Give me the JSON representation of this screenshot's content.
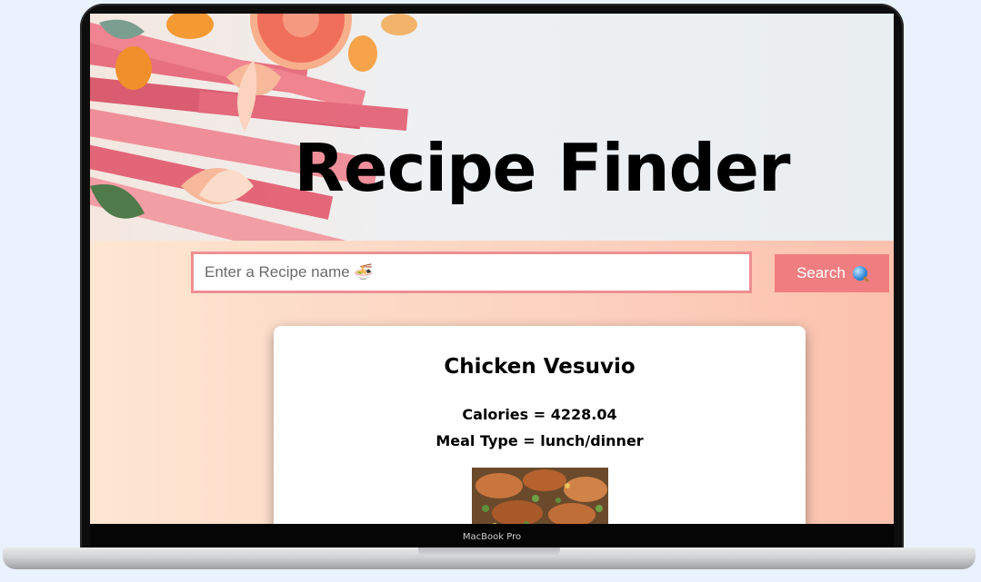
{
  "device": {
    "model_label": "MacBook Pro"
  },
  "hero": {
    "title": "Recipe Finder"
  },
  "search": {
    "placeholder": "Enter a Recipe name 🍜",
    "button_label": "Search"
  },
  "recipe": {
    "name": "Chicken Vesuvio",
    "calories_line": "Calories = 4228.04",
    "meal_type_line": "Meal Type = lunch/dinner"
  },
  "colors": {
    "accent": "#f07e80",
    "input_border": "#ee8f93",
    "background_left": "#fde6d2",
    "background_right": "#fbc1ad"
  },
  "icons": {
    "search_button_icon": "magnifying-glass-icon"
  }
}
